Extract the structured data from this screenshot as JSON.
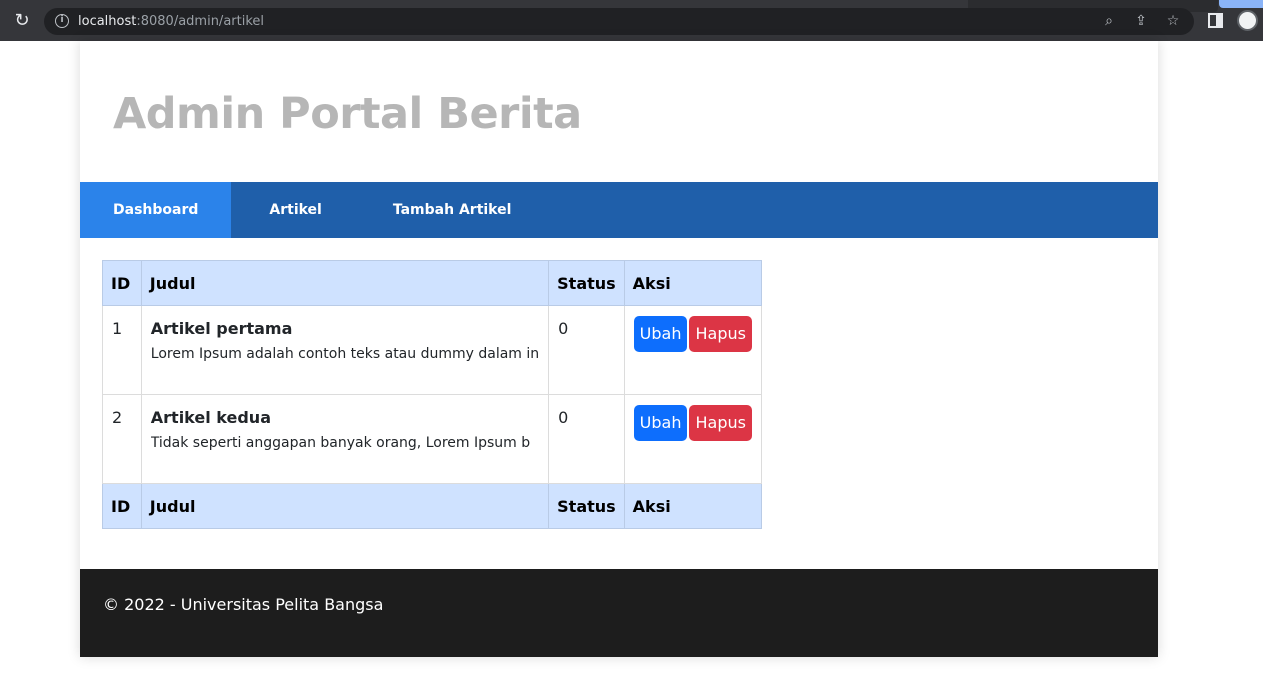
{
  "browser": {
    "url_host": "localhost",
    "url_rest": ":8080/admin/artikel"
  },
  "header": {
    "title": "Admin Portal Berita"
  },
  "nav": {
    "items": [
      {
        "label": "Dashboard"
      },
      {
        "label": "Artikel"
      },
      {
        "label": "Tambah Artikel"
      }
    ]
  },
  "table": {
    "headers": [
      "ID",
      "Judul",
      "Status",
      "Aksi"
    ],
    "rows": [
      {
        "id": "1",
        "title": "Artikel pertama",
        "excerpt": "Lorem Ipsum adalah contoh teks atau dummy dalam in",
        "status": "0",
        "edit_label": "Ubah",
        "delete_label": "Hapus"
      },
      {
        "id": "2",
        "title": "Artikel kedua",
        "excerpt": "Tidak seperti anggapan banyak orang, Lorem Ipsum b",
        "status": "0",
        "edit_label": "Ubah",
        "delete_label": "Hapus"
      }
    ]
  },
  "footer": {
    "text": "© 2022 - Universitas Pelita Bangsa"
  },
  "colors": {
    "navbar": "#1f5faa",
    "nav_active": "#2b83ea",
    "table_header": "#cfe2ff",
    "edit_button": "#0d6efd",
    "delete_button": "#dc3545",
    "footer": "#1d1d1d"
  },
  "icons": [
    "reload-icon",
    "info-icon",
    "zoom-icon",
    "share-icon",
    "star-icon",
    "side-panel-icon",
    "profile-avatar"
  ]
}
